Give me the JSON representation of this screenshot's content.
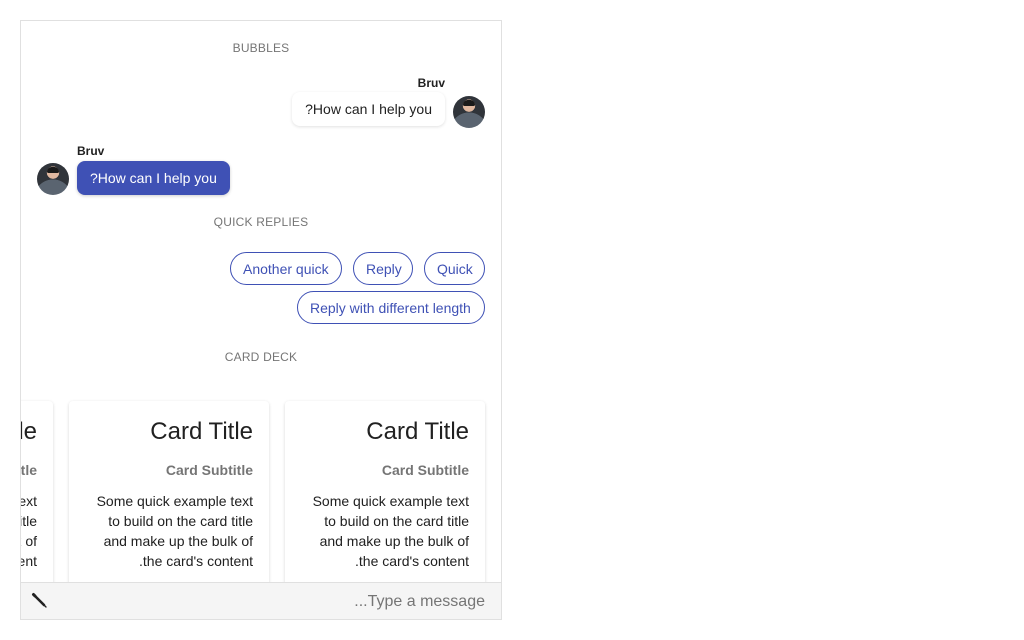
{
  "sections": {
    "bubbles": "BUBBLES",
    "quick_replies": "QUICK REPLIES",
    "card_deck": "CARD DECK"
  },
  "messages": [
    {
      "sender": "Bruv",
      "text": "?How can I help you",
      "direction": "outgoing"
    },
    {
      "sender": "Bruv",
      "text": "?How can I help you",
      "direction": "incoming"
    }
  ],
  "quick_replies": [
    "Another quick",
    "Reply",
    "Quick",
    "Reply with different length"
  ],
  "cards": [
    {
      "title": "Card Title",
      "subtitle": "Card Subtitle",
      "text": "Some quick example text to build on the card title and make up the bulk of .the card's content"
    },
    {
      "title": "Card Title",
      "subtitle": "Card Subtitle",
      "text": "Some quick example text to build on the card title and make up the bulk of .the card's content"
    },
    {
      "title": "Card Title",
      "subtitle": "Card Subtitle",
      "text": "Some quick example text to build on the card title and make up the bulk of .the card's content"
    }
  ],
  "composer": {
    "placeholder": "...Type a message",
    "attach_icon": "pencil-icon"
  },
  "colors": {
    "accent": "#3f51b5",
    "muted": "#757575",
    "composer_bg": "#f5f5f5"
  }
}
